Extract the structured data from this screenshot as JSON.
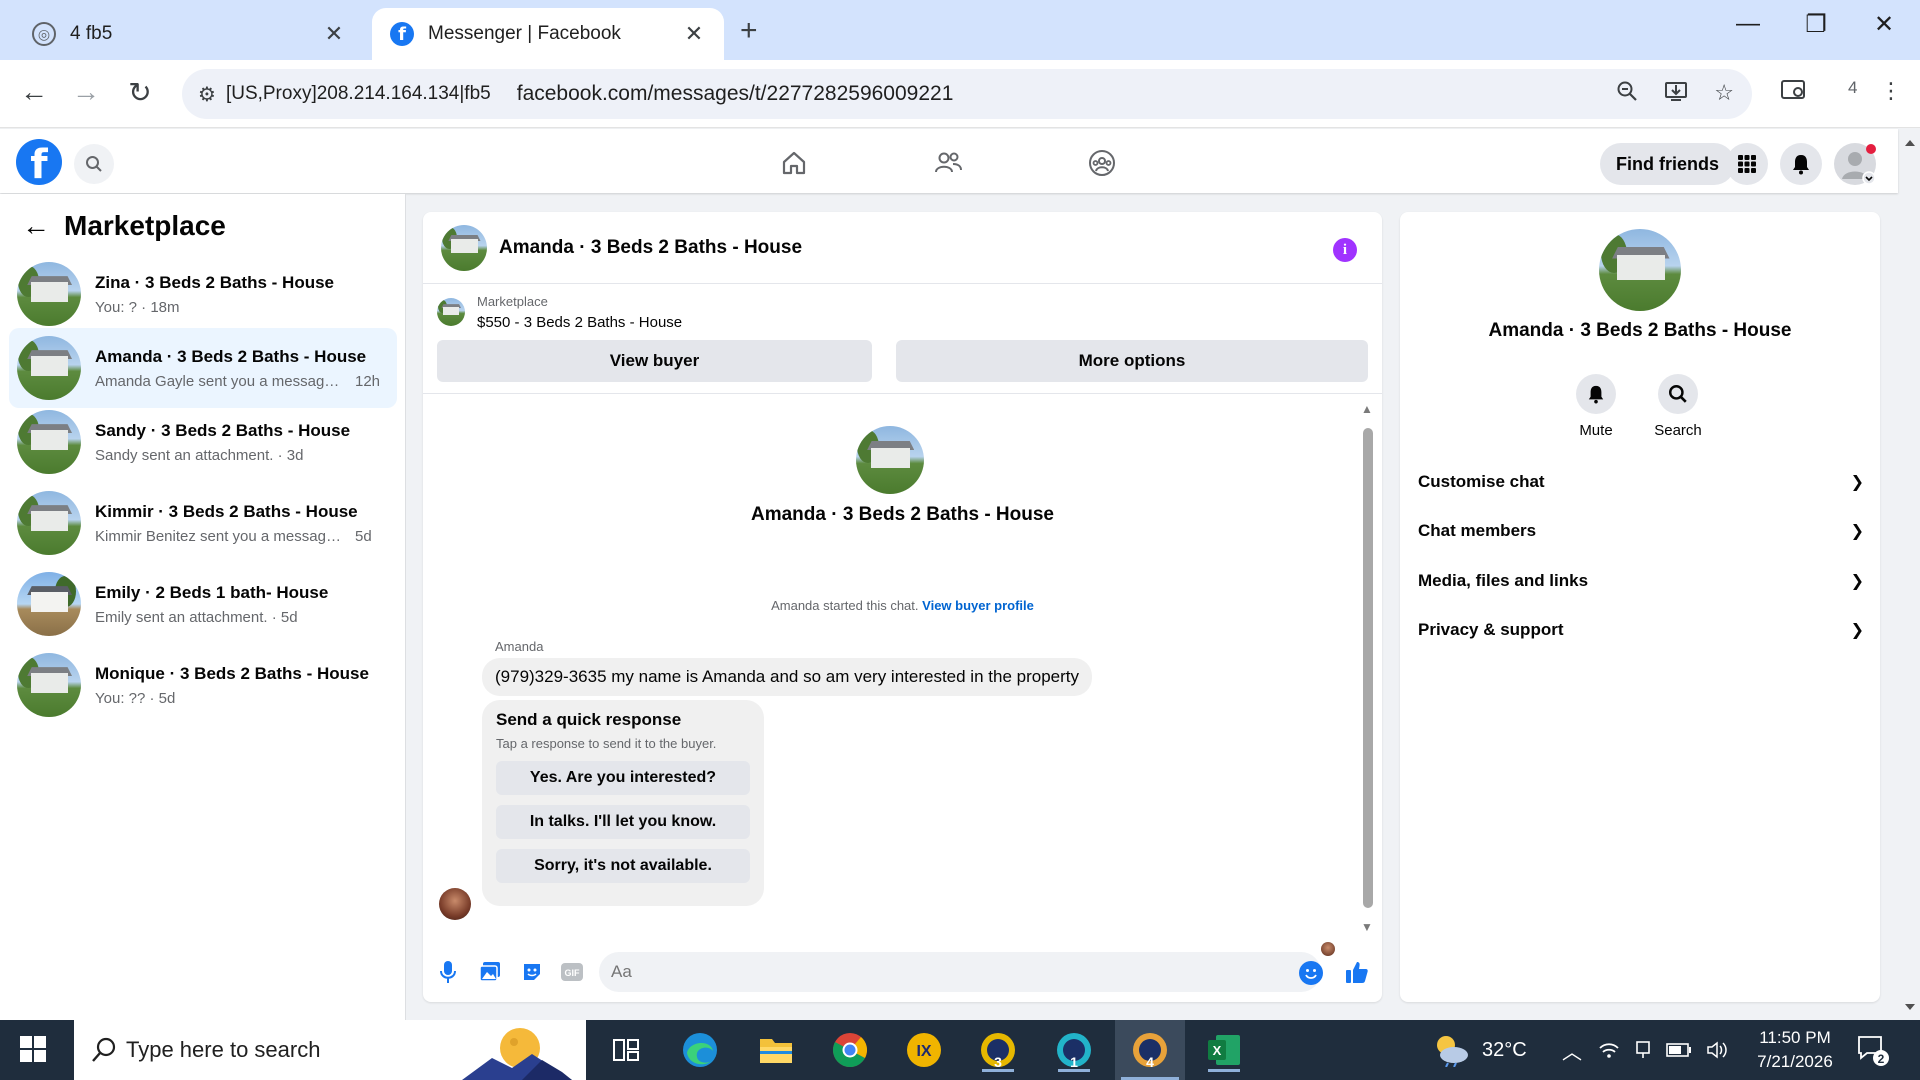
{
  "browser": {
    "tabs": [
      {
        "title": "4 fb5"
      },
      {
        "title": "Messenger | Facebook"
      }
    ],
    "address": {
      "proxy": "[US,Proxy]208.214.164.134|fb5",
      "url": "facebook.com/messages/t/2277282596009221"
    },
    "profile_count": "4"
  },
  "header": {
    "find_friends": "Find friends"
  },
  "sidebar": {
    "title": "Marketplace",
    "conversations": [
      {
        "name": "Zina · 3 Beds 2 Baths - House",
        "preview": "You: ? · 18m",
        "time": ""
      },
      {
        "name": "Amanda · 3 Beds 2 Baths - House",
        "preview": "Amanda Gayle sent you a message ...",
        "time": "12h"
      },
      {
        "name": "Sandy · 3 Beds 2 Baths - House",
        "preview": "Sandy sent an attachment. · 3d",
        "time": ""
      },
      {
        "name": "Kimmir · 3 Beds 2 Baths - House",
        "preview": "Kimmir Benitez sent you a message ...",
        "time": "5d"
      },
      {
        "name": "Emily · 2 Beds 1 bath- House",
        "preview": "Emily sent an attachment. · 5d",
        "time": ""
      },
      {
        "name": "Monique · 3 Beds 2 Baths - House",
        "preview": "You: ?? · 5d",
        "time": ""
      }
    ]
  },
  "chat": {
    "title": "Amanda · 3 Beds 2 Baths - House",
    "marketplace_label": "Marketplace",
    "listing": "$550 - 3 Beds 2 Baths - House",
    "view_buyer": "View buyer",
    "more_options": "More options",
    "intro_name": "Amanda · 3 Beds 2 Baths - House",
    "started_note": "Amanda started this chat.",
    "view_profile": "View buyer profile",
    "sender": "Amanda",
    "message": "(979)329-3635 my name is Amanda and so am very interested in the property",
    "quick": {
      "title": "Send a quick response",
      "subtitle": "Tap a response to send it to the buyer.",
      "options": [
        "Yes. Are you interested?",
        "In talks. I'll let you know.",
        "Sorry, it's not available."
      ]
    },
    "composer_placeholder": "Aa"
  },
  "info_panel": {
    "name": "Amanda · 3 Beds 2 Baths - House",
    "actions": [
      {
        "label": "Mute",
        "icon": "bell-icon"
      },
      {
        "label": "Search",
        "icon": "search-icon"
      }
    ],
    "sections": [
      "Customise chat",
      "Chat members",
      "Media, files and links",
      "Privacy & support"
    ]
  },
  "taskbar": {
    "search_placeholder": "Type here to search",
    "weather": "32°C",
    "time": "11:50 PM",
    "date": "7/21/2026",
    "notification_count": "2",
    "app_badges": [
      "3",
      "1",
      "4"
    ]
  },
  "colors": {
    "fb_blue": "#1877f2",
    "link_blue": "#0064d1",
    "info_purple": "#a033ff",
    "tabstrip": "#d3e3fd",
    "taskbar": "#1f2d3d"
  }
}
